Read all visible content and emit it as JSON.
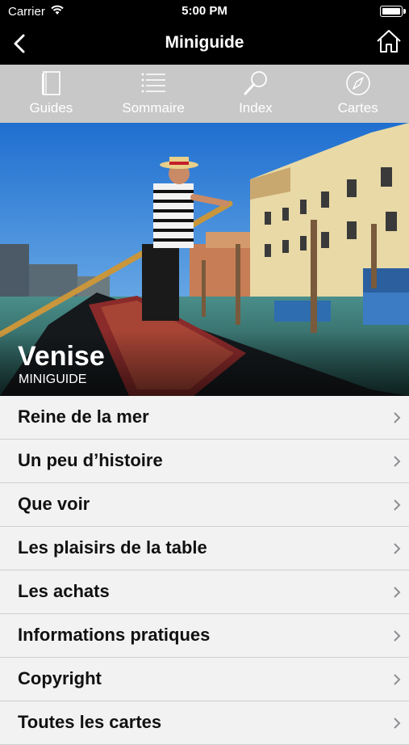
{
  "status_bar": {
    "carrier": "Carrier",
    "time": "5:00 PM"
  },
  "nav": {
    "title": "Miniguide"
  },
  "tabs": [
    {
      "label": "Guides",
      "icon": "book-icon"
    },
    {
      "label": "Sommaire",
      "icon": "list-icon"
    },
    {
      "label": "Index",
      "icon": "magnifier-icon"
    },
    {
      "label": "Cartes",
      "icon": "compass-icon"
    }
  ],
  "hero": {
    "title": "Venise",
    "subtitle": "MINIGUIDE"
  },
  "menu": [
    {
      "label": "Reine de la mer"
    },
    {
      "label": "Un peu d’histoire"
    },
    {
      "label": "Que voir"
    },
    {
      "label": "Les plaisirs de la table"
    },
    {
      "label": "Les achats"
    },
    {
      "label": "Informations pratiques"
    },
    {
      "label": "Copyright"
    },
    {
      "label": "Toutes les cartes"
    }
  ],
  "colors": {
    "bar": "#000000",
    "toolbar": "#c8c8c8",
    "list_bg": "#f2f2f2",
    "chevron": "#8e8e93"
  }
}
